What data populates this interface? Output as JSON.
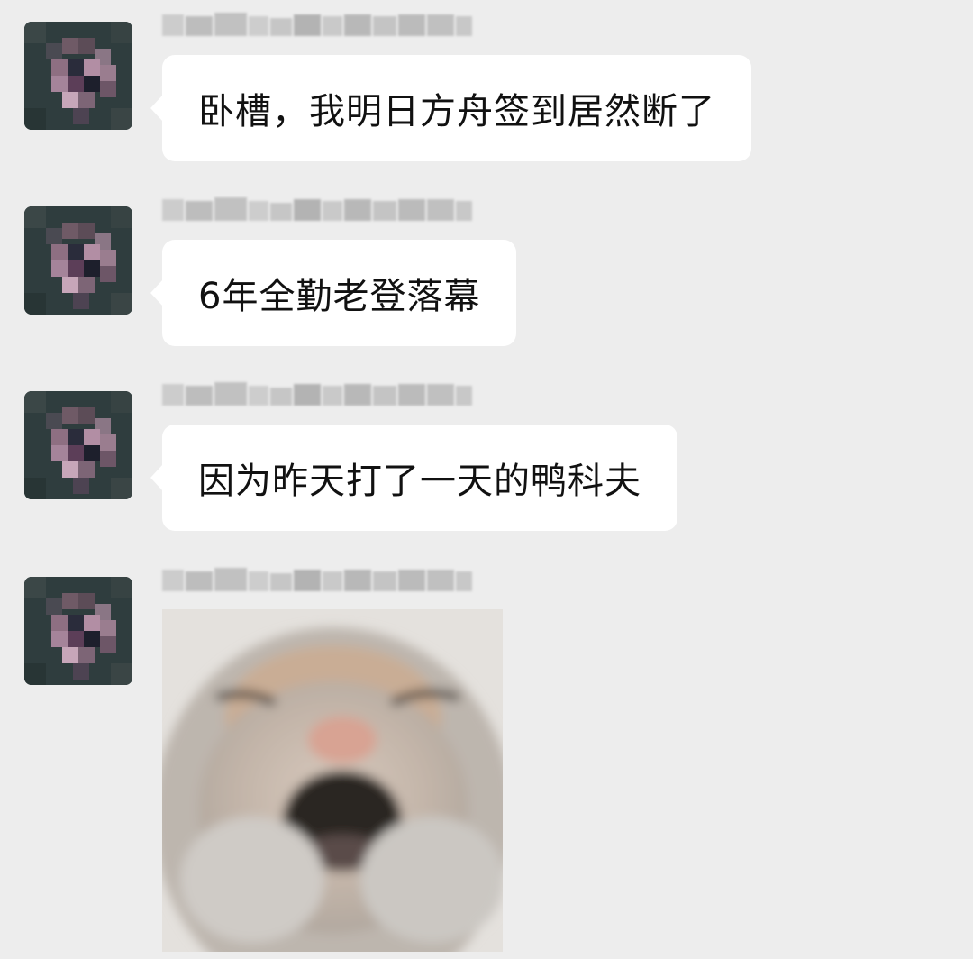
{
  "chat": {
    "messages": [
      {
        "type": "text",
        "text": "卧槽，我明日方舟签到居然断了"
      },
      {
        "type": "text",
        "text": "6年全勤老登落幕"
      },
      {
        "type": "text",
        "text": "因为昨天打了一天的鸭科夫"
      },
      {
        "type": "image",
        "image": "blurry-screaming-cat-sticker"
      }
    ],
    "avatar_icon": "pixelated-avatar-icon",
    "nickname_state": "pixelated-nickname"
  },
  "colors": {
    "background": "#ededed",
    "bubble": "#ffffff",
    "text": "#111111",
    "avatar_base": "#2d3b3c"
  }
}
